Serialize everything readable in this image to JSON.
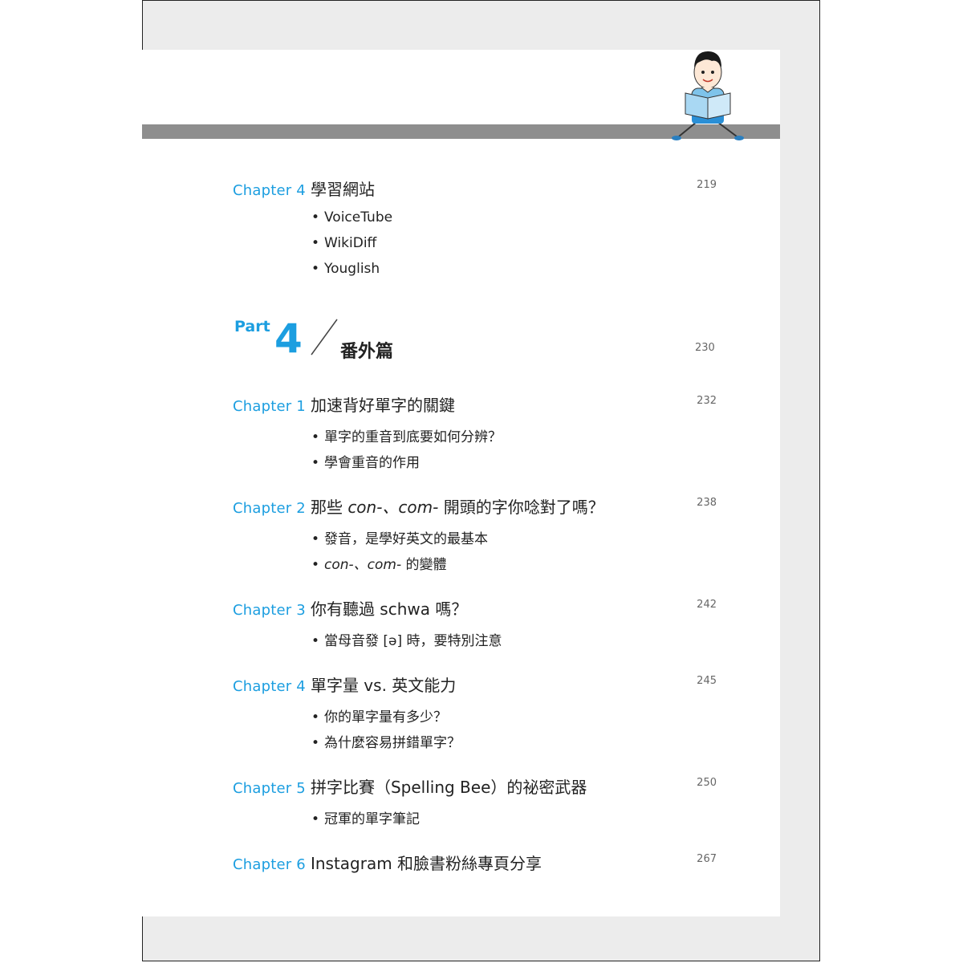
{
  "entries_top": {
    "chapter": "Chapter 4",
    "title": "學習網站",
    "page": "219",
    "bullets": [
      "VoiceTube",
      "WikiDiff",
      "Youglish"
    ]
  },
  "part": {
    "word": "Part",
    "number": "4",
    "title": "番外篇",
    "page": "230"
  },
  "chapters": [
    {
      "chapter": "Chapter 1",
      "title": "加速背好單字的關鍵",
      "page": "232",
      "bullets": [
        "單字的重音到底要如何分辨？",
        "學會重音的作用"
      ]
    },
    {
      "chapter": "Chapter 2",
      "title_pre": "那些 ",
      "title_it": "con-、com-",
      "title_post": " 開頭的字你唸對了嗎？",
      "page": "238",
      "bullets": [
        "發音，是學好英文的最基本"
      ],
      "bullet2_it": "con-、com-",
      "bullet2_post": " 的變體"
    },
    {
      "chapter": "Chapter 3",
      "title": "你有聽過 schwa 嗎？",
      "page": "242",
      "bullets": [
        "當母音發 [ə] 時，要特別注意"
      ]
    },
    {
      "chapter": "Chapter 4",
      "title": "單字量 vs. 英文能力",
      "page": "245",
      "bullets": [
        "你的單字量有多少？",
        "為什麼容易拼錯單字？"
      ]
    },
    {
      "chapter": "Chapter 5",
      "title": "拼字比賽（Spelling Bee）的祕密武器",
      "page": "250",
      "bullets": [
        "冠軍的單字筆記"
      ]
    },
    {
      "chapter": "Chapter 6",
      "title": "Instagram 和臉書粉絲專頁分享",
      "page": "267",
      "bullets": []
    }
  ],
  "bullet_char": "•",
  "colors": {
    "accent": "#1c9ee0",
    "bar": "#8e8e8e",
    "boy_shirt": "#7ec3ea",
    "boy_hair": "#1a1a1a"
  },
  "illustration": "boy-reading-book-icon"
}
